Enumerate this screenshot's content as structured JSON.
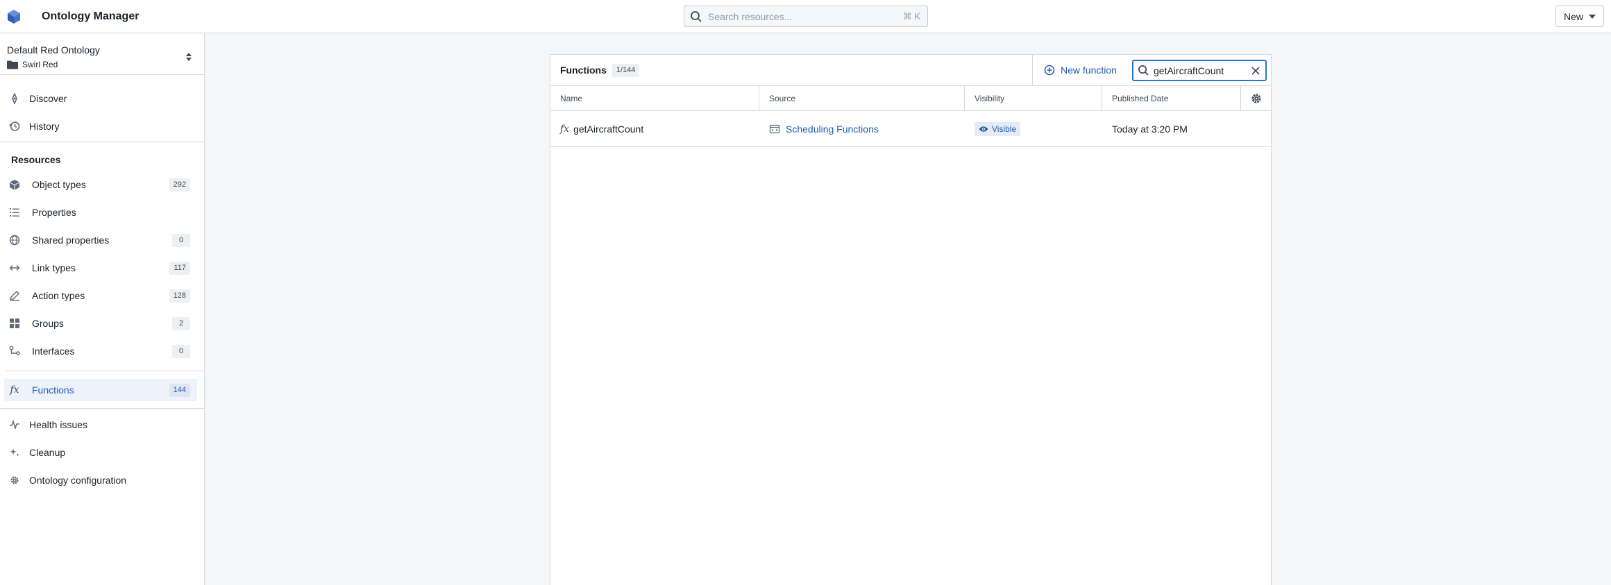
{
  "app": {
    "title": "Ontology Manager"
  },
  "search": {
    "placeholder": "Search resources...",
    "shortcut": "⌘ K"
  },
  "header": {
    "new_label": "New"
  },
  "sidebar": {
    "ontology_name": "Default Red Ontology",
    "ontology_folder": "Swirl Red",
    "top_items": [
      {
        "label": "Discover",
        "icon": "compass-icon"
      },
      {
        "label": "History",
        "icon": "history-icon"
      }
    ],
    "resources_heading": "Resources",
    "resources": [
      {
        "label": "Object types",
        "count": "292",
        "icon": "cube-icon"
      },
      {
        "label": "Properties",
        "count": "",
        "icon": "list-icon"
      },
      {
        "label": "Shared properties",
        "count": "0",
        "icon": "globe-icon"
      },
      {
        "label": "Link types",
        "count": "117",
        "icon": "arrows-horizontal-icon"
      },
      {
        "label": "Action types",
        "count": "128",
        "icon": "edit-icon"
      },
      {
        "label": "Groups",
        "count": "2",
        "icon": "grid-icon"
      },
      {
        "label": "Interfaces",
        "count": "0",
        "icon": "interface-icon"
      }
    ],
    "functions": {
      "label": "Functions",
      "count": "144",
      "icon": "function-icon"
    },
    "bottom_items": [
      {
        "label": "Health issues",
        "icon": "pulse-icon"
      },
      {
        "label": "Cleanup",
        "icon": "sparkle-icon"
      },
      {
        "label": "Ontology configuration",
        "icon": "gear-icon"
      }
    ]
  },
  "panel": {
    "title": "Functions",
    "badge": "1/144",
    "new_function_label": "New function",
    "search_value": "getAircraftCount",
    "columns": [
      "Name",
      "Source",
      "Visibility",
      "Published Date"
    ],
    "rows": [
      {
        "name": "getAircraftCount",
        "source": "Scheduling Functions",
        "visibility": "Visible",
        "published": "Today at 3:20 PM"
      }
    ]
  },
  "colors": {
    "accent": "#215db0",
    "active_bg": "#edf2fb",
    "border": "#d5d9de"
  }
}
